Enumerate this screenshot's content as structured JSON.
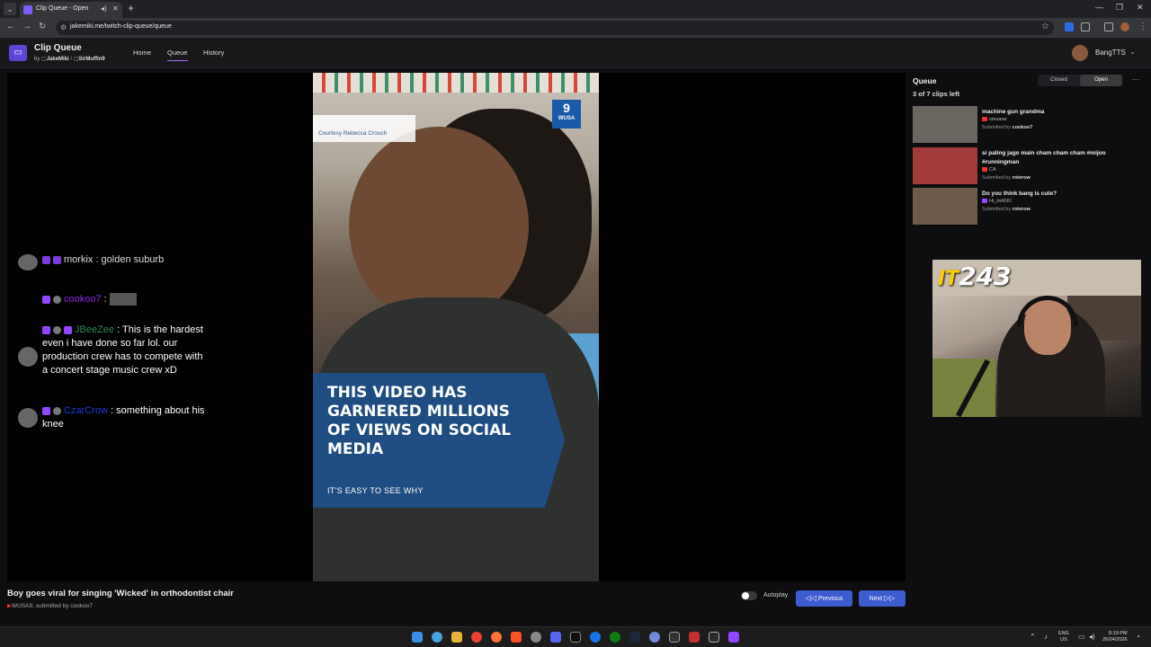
{
  "browser": {
    "tab_title": "Clip Queue - Open",
    "url": "jakemiki.me/twitch-clip-queue/queue",
    "nav_icons": [
      "back-icon",
      "forward-icon",
      "reload-icon"
    ]
  },
  "header": {
    "title": "Clip Queue",
    "by_prefix": "by",
    "author_1": "JakeMiki",
    "separator": "/",
    "author_2": "SirMuffin9",
    "nav": [
      "Home",
      "Queue",
      "History"
    ],
    "active_nav": "Queue",
    "username": "BangTTS"
  },
  "chat": {
    "partial_line": "morkix : golden suburb",
    "messages": [
      {
        "user": "cookoo7",
        "user_color": "#8a2be2",
        "sep": " :",
        "text": ""
      },
      {
        "user": "JBeeZee",
        "user_color": "#2e8b57",
        "sep": " : ",
        "text": "This is the hardest even i have done so far lol. our production crew has to compete with a concert stage music crew xD"
      },
      {
        "user": "CzarCrow",
        "user_color": "#1e3cd6",
        "sep": " : ",
        "text": "something about his knee"
      }
    ]
  },
  "video": {
    "courtesy": "Courtesy Rebecca Crouch",
    "logo_number": "9",
    "logo_text": "WUSA",
    "headline": "THIS VIDEO HAS GARNERED MILLIONS OF VIEWS ON SOCIAL MEDIA",
    "subline": "IT'S EASY TO SEE WHY"
  },
  "clip": {
    "title": "Boy goes viral for singing 'Wicked' in orthodontist chair",
    "channel": "WUSA9",
    "submitted_prefix": ", submitted by",
    "submitter": "cookoo7"
  },
  "controls": {
    "autoplay_label": "Autoplay",
    "autoplay_on": false,
    "previous_label": "Previous",
    "next_label": "Next",
    "accent": "#3c5ccf"
  },
  "queue": {
    "title": "Queue",
    "closed_label": "Closed",
    "open_label": "Open",
    "state": "Open",
    "count_text": "3 of 7 clips left",
    "submitted_label": "Submitted by",
    "items": [
      {
        "title": "machine gun grandma",
        "channel": "smuane",
        "platform": "youtube",
        "submitter": "cookoo7",
        "thumb": "#6b6660"
      },
      {
        "title": "si paling jago main cham cham cham #mijoo #runningman",
        "channel": "CA",
        "platform": "youtube",
        "submitter": "roterow",
        "thumb": "#a23a3a"
      },
      {
        "title": "Do you think bang is cute?",
        "channel": "Hi_ImKIKI",
        "platform": "twitch",
        "submitter": "roterow",
        "thumb": "#6d5a48"
      }
    ]
  },
  "webcam": {
    "prefix": "IT",
    "number": "243"
  },
  "taskbar": {
    "lang_1": "ENG",
    "lang_2": "US",
    "time": "8:19 PM",
    "date": "26/04/2026"
  }
}
